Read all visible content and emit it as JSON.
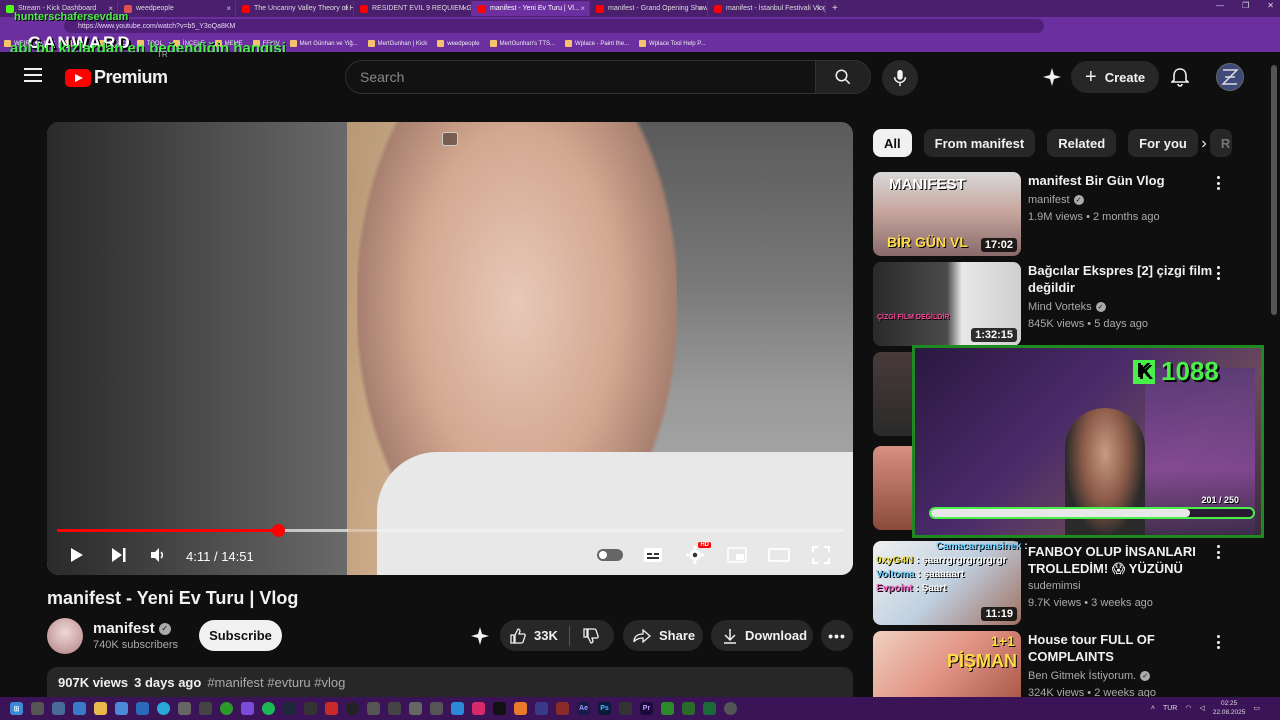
{
  "browser": {
    "tabs": [
      {
        "label": "Stream - Kick Dashboard",
        "color": "#53fc18"
      },
      {
        "label": "weedpeople",
        "color": "#e05050"
      },
      {
        "label": "The Uncanny Valley Theory of H...",
        "color": "#ff0000"
      },
      {
        "label": "RESIDENT EVIL 9 REQUIEM Game...",
        "color": "#ff0000"
      },
      {
        "label": "manifest - Yeni Ev Turu | Vl...",
        "color": "#ff0000"
      },
      {
        "label": "manifest - Grand Opening Show...",
        "color": "#ff0000"
      },
      {
        "label": "manifest - İstanbul Festivali Vlog...",
        "color": "#ff0000"
      }
    ],
    "new_tab": "+",
    "url": "https://www.youtube.com/watch?v=b5_Y3oQa8KM",
    "bookmarks": [
      "WEIRD MUSIC",
      "JIRA",
      "INSPO",
      "TOOL",
      "İNCELE",
      "MEME",
      "FFXIV",
      "Mert Günhan ve Yiğ...",
      "MertGunhan | Kick",
      "weedpeople",
      "MertGunhan's TTS...",
      "Wplace - Paint the...",
      "Wplace Tool Help P..."
    ]
  },
  "overlay": {
    "username": "hunterschafersevdam",
    "logo": "GANWARD",
    "caption": "abi bu kızlardan en beğendiğin hangisi"
  },
  "header": {
    "logo_text": "Premium",
    "country": "TR",
    "search_placeholder": "Search",
    "create_label": "Create"
  },
  "player": {
    "current_time": "4:11",
    "duration": "14:51",
    "progress_fraction": 0.2817,
    "buffered_fraction": 0.37,
    "hd_badge": "HD"
  },
  "video": {
    "title": "manifest - Yeni Ev Turu | Vlog",
    "channel": "manifest",
    "subscribers": "740K subscribers",
    "subscribe_label": "Subscribe",
    "likes": "33K",
    "share_label": "Share",
    "download_label": "Download",
    "views": "907K views",
    "age": "3 days ago",
    "tags": "#manifest #evturu #vlog"
  },
  "sidebar": {
    "chips": [
      "All",
      "From manifest",
      "Related",
      "For you",
      "R"
    ],
    "recommendations": [
      {
        "title": "manifest Bir Gün Vlog",
        "channel": "manifest",
        "verified": true,
        "meta": "1.9M views • 2 months ago",
        "duration": "17:02",
        "thumb_text_1": "MANIFEST",
        "thumb_text_2": "BİR GÜN VL"
      },
      {
        "title": "Bağcılar Ekspres [2] çizgi film değildir",
        "channel": "Mind Vorteks",
        "verified": true,
        "meta": "845K views • 5 days ago",
        "duration": "1:32:15",
        "thumb_text_1": "ÇİZGİ FİLM DEĞİLDİR"
      },
      {
        "title": "FANBOY OLUP İNSANLARI TROLLEDİM! 😱 YÜZÜNÜ ATTI...",
        "channel": "sudemimsi",
        "verified": false,
        "meta": "9.7K views • 3 weeks ago",
        "duration": "11:19"
      },
      {
        "title": "House tour FULL OF COMPLAINTS",
        "channel": "Ben Gitmek İstiyorum.",
        "verified": true,
        "meta": "324K views • 2 weeks ago",
        "duration": "",
        "thumb_text_1": "1+1",
        "thumb_text_2": "PİŞMAN"
      }
    ]
  },
  "webcam": {
    "kick_count": "1088",
    "goal_progress": "201 / 250",
    "goal_current": 201,
    "goal_total": 250
  },
  "chat_overlay": [
    {
      "user": "Camacarpansinek",
      "text": "",
      "color": "#6ad0ff"
    },
    {
      "user": "0xyG4N",
      "text": "şaarrgrgrgrgrgrgr",
      "color": "#f0e040"
    },
    {
      "user": "Voltoma",
      "text": "şaaaaart",
      "color": "#6ad0ff"
    },
    {
      "user": "Evpoint",
      "text": "Şaart",
      "color": "#ff6ad0"
    }
  ],
  "taskbar": {
    "lang": "TUR",
    "time": "02:25",
    "date": "22.08.2025"
  }
}
